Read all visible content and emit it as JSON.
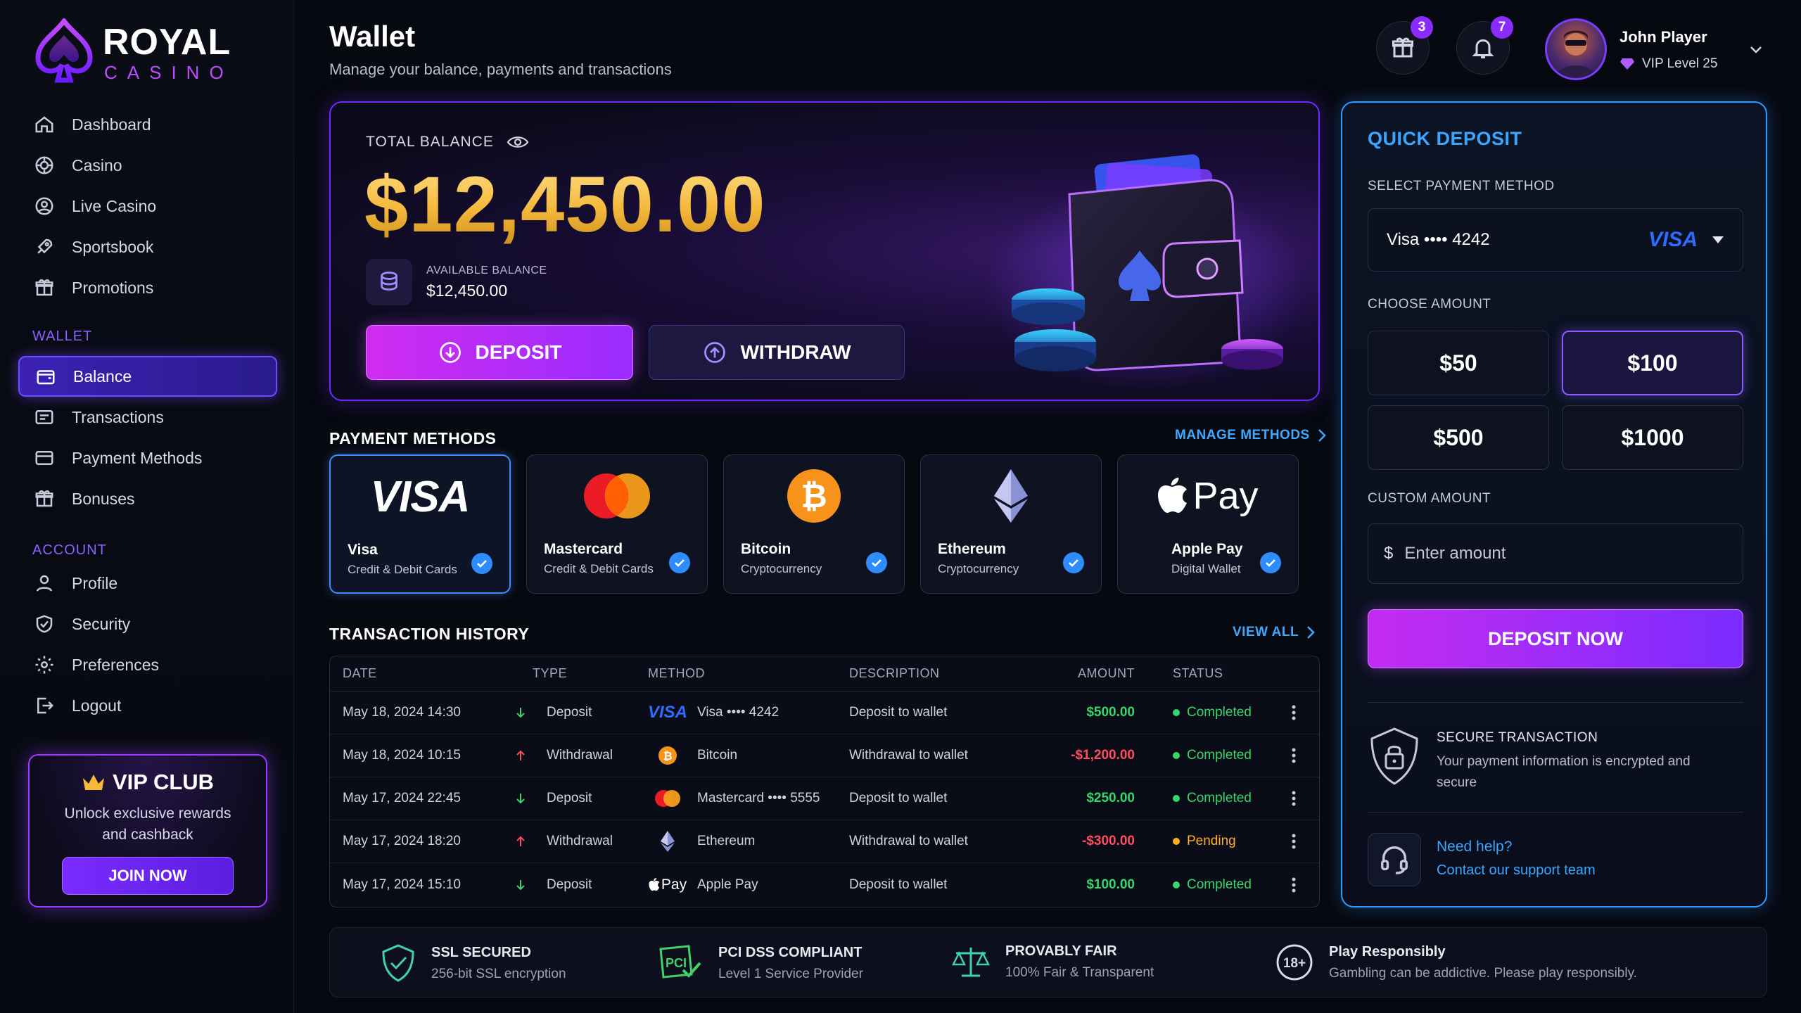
{
  "brand": {
    "name": "ROYAL",
    "sub": "CASINO"
  },
  "sidebar": {
    "main": [
      {
        "label": "Dashboard",
        "icon": "home-icon"
      },
      {
        "label": "Casino",
        "icon": "chip-icon"
      },
      {
        "label": "Live Casino",
        "icon": "user-circle-icon"
      },
      {
        "label": "Sportsbook",
        "icon": "rocket-icon"
      },
      {
        "label": "Promotions",
        "icon": "gift-icon"
      }
    ],
    "wallet_section": "WALLET",
    "wallet": [
      {
        "label": "Balance",
        "icon": "wallet-icon"
      },
      {
        "label": "Transactions",
        "icon": "list-icon"
      },
      {
        "label": "Payment Methods",
        "icon": "card-icon"
      },
      {
        "label": "Bonuses",
        "icon": "gift-icon"
      }
    ],
    "account_section": "ACCOUNT",
    "account": [
      {
        "label": "Profile",
        "icon": "user-icon"
      },
      {
        "label": "Security",
        "icon": "shield-check-icon"
      },
      {
        "label": "Preferences",
        "icon": "gear-icon"
      },
      {
        "label": "Logout",
        "icon": "logout-icon"
      }
    ],
    "vip": {
      "title": "VIP CLUB",
      "desc": "Unlock exclusive rewards and cashback",
      "button": "JOIN NOW"
    }
  },
  "header": {
    "title": "Wallet",
    "subtitle": "Manage your balance, payments and transactions",
    "gift_count": "3",
    "notif_count": "7",
    "user_name": "John Player",
    "user_level": "VIP Level 25"
  },
  "balance": {
    "label": "TOTAL BALANCE",
    "amount": "$12,450.00",
    "available_label": "AVAILABLE BALANCE",
    "available_value": "$12,450.00",
    "deposit": "DEPOSIT",
    "withdraw": "WITHDRAW"
  },
  "payment_methods": {
    "title": "PAYMENT METHODS",
    "manage": "MANAGE METHODS",
    "items": [
      {
        "name": "Visa",
        "sub": "Credit & Debit Cards",
        "logo": "VISA"
      },
      {
        "name": "Mastercard",
        "sub": "Credit & Debit Cards"
      },
      {
        "name": "Bitcoin",
        "sub": "Cryptocurrency"
      },
      {
        "name": "Ethereum",
        "sub": "Cryptocurrency"
      },
      {
        "name": "Apple Pay",
        "sub": "Digital Wallet",
        "logo": "Pay"
      }
    ]
  },
  "transactions": {
    "title": "TRANSACTION HISTORY",
    "view_all": "VIEW ALL",
    "columns": [
      "DATE",
      "TYPE",
      "METHOD",
      "DESCRIPTION",
      "AMOUNT",
      "STATUS"
    ],
    "rows": [
      {
        "date": "May 18, 2024 14:30",
        "type": "Deposit",
        "dir": "in",
        "method_logo": "VISA",
        "method": "Visa •••• 4242",
        "desc": "Deposit to wallet",
        "amount": "$500.00",
        "status": "Completed"
      },
      {
        "date": "May 18, 2024 10:15",
        "type": "Withdrawal",
        "dir": "out",
        "method_logo": "btc",
        "method": "Bitcoin",
        "desc": "Withdrawal to wallet",
        "amount": "-$1,200.00",
        "status": "Completed"
      },
      {
        "date": "May 17, 2024 22:45",
        "type": "Deposit",
        "dir": "in",
        "method_logo": "mc",
        "method": "Mastercard •••• 5555",
        "desc": "Deposit to wallet",
        "amount": "$250.00",
        "status": "Completed"
      },
      {
        "date": "May 17, 2024 18:20",
        "type": "Withdrawal",
        "dir": "out",
        "method_logo": "eth",
        "method": "Ethereum",
        "desc": "Withdrawal to wallet",
        "amount": "-$300.00",
        "status": "Pending"
      },
      {
        "date": "May 17, 2024 15:10",
        "type": "Deposit",
        "dir": "in",
        "method_logo": "Pay",
        "method": "Apple Pay",
        "desc": "Deposit to wallet",
        "amount": "$100.00",
        "status": "Completed"
      }
    ]
  },
  "quick_deposit": {
    "title": "QUICK DEPOSIT",
    "method_label": "SELECT PAYMENT METHOD",
    "method_value": "Visa •••• 4242",
    "method_logo": "VISA",
    "amount_label": "CHOOSE AMOUNT",
    "amounts": [
      "$50",
      "$100",
      "$500",
      "$1000"
    ],
    "custom_label": "CUSTOM AMOUNT",
    "currency": "$",
    "custom_placeholder": "Enter amount",
    "button": "DEPOSIT NOW",
    "secure_title": "SECURE TRANSACTION",
    "secure_text": "Your payment information is encrypted and secure",
    "help_title": "Need help?",
    "help_link": "Contact our support team"
  },
  "footer": [
    {
      "title": "SSL SECURED",
      "sub": "256-bit SSL encryption",
      "icon": "shield-check-icon"
    },
    {
      "title": "PCI DSS COMPLIANT",
      "sub": "Level 1 Service Provider",
      "icon": "pci-icon",
      "badge": "PCI"
    },
    {
      "title": "PROVABLY FAIR",
      "sub": "100% Fair & Transparent",
      "icon": "scales-icon"
    },
    {
      "title": "Play Responsibly",
      "sub": "Gambling can be addictive. Please play responsibly.",
      "icon": "age-18-icon",
      "badge": "18+"
    }
  ],
  "colors": {
    "accent_purple": "#8b2cff",
    "accent_blue": "#2e9cff",
    "gold": "#f4b93c",
    "positive": "#38d66b",
    "negative": "#ff4d5e",
    "pending": "#ffb020"
  }
}
